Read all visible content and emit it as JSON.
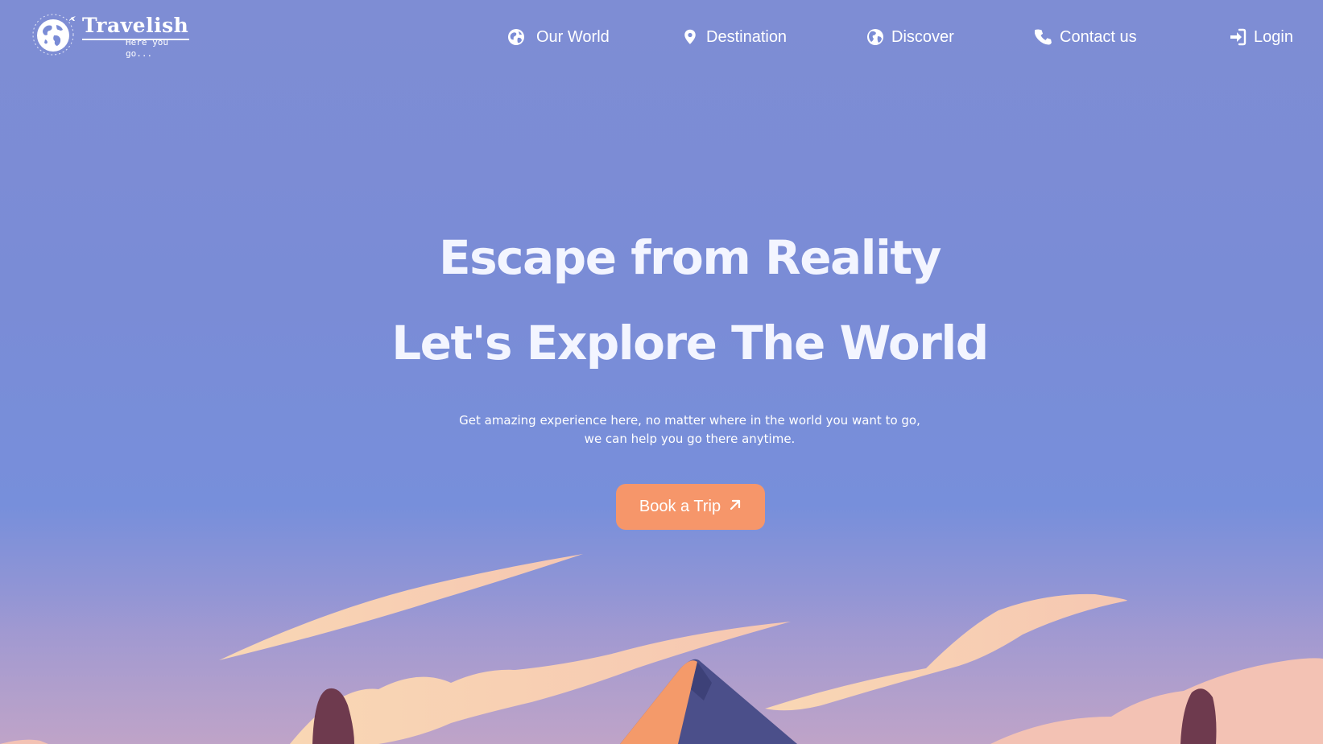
{
  "brand": {
    "name": "Travelish",
    "tagline": "Here you go..."
  },
  "nav": {
    "our_world": "Our World",
    "destination": "Destination",
    "discover": "Discover",
    "contact": "Contact us",
    "login": "Login"
  },
  "hero": {
    "title_line1": "Escape from Reality",
    "title_line2": "Let's Explore The World",
    "subtitle_line1": "Get amazing experience here, no matter where in the world you want to go,",
    "subtitle_line2": "we can help you go there anytime.",
    "cta_label": "Book a Trip"
  },
  "icons": {
    "logo": "globe-plane-icon",
    "our_world": "globe-icon",
    "destination": "map-pin-icon",
    "discover": "globe-americas-icon",
    "contact": "phone-icon",
    "login": "sign-in-icon",
    "cta": "arrow-up-right-icon"
  },
  "colors": {
    "background": "#7a8cd6",
    "cta": "#f6966a",
    "text": "#ffffff",
    "cloud": "#f6d2b2",
    "mountain_dark": "#4b4f8a",
    "mountain_light": "#f49a6a",
    "tree": "#6e3a4e"
  }
}
